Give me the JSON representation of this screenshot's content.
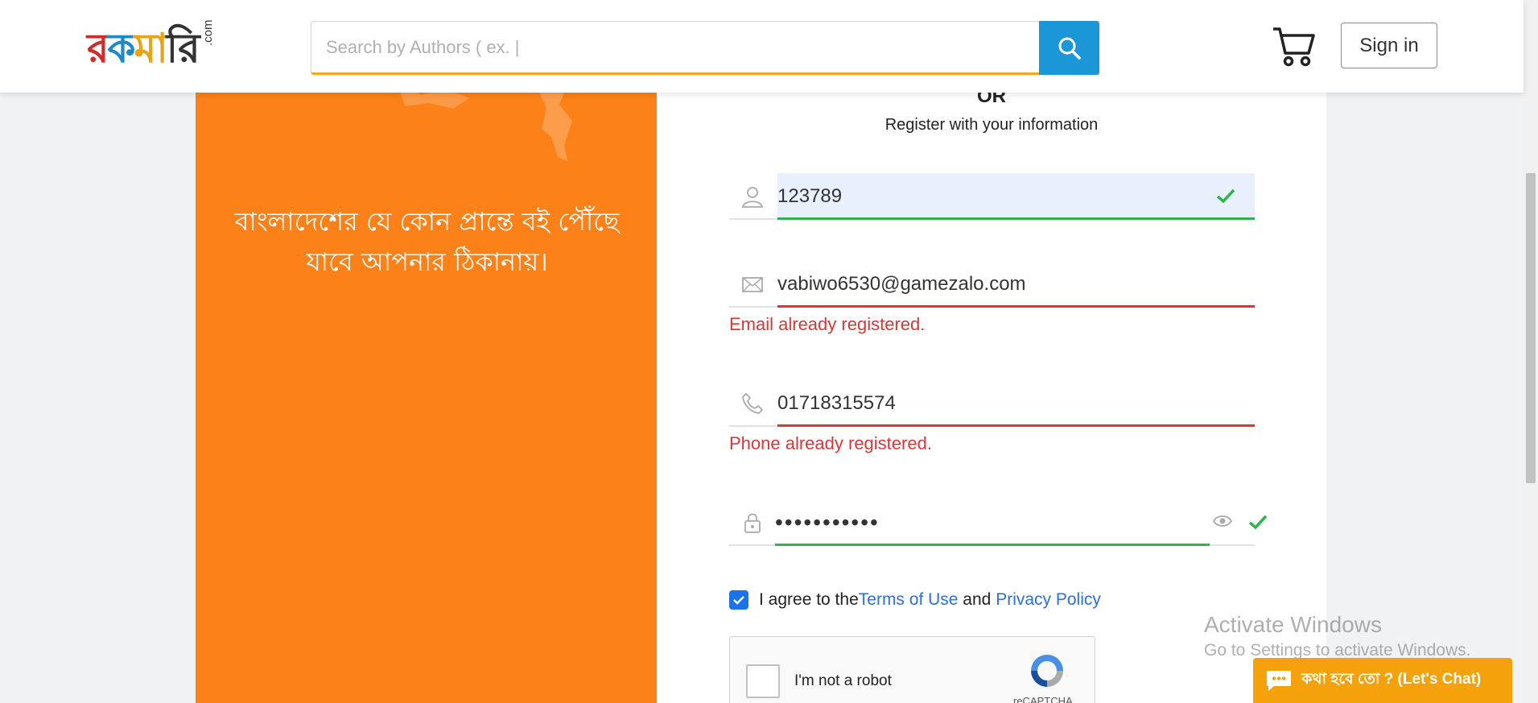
{
  "header": {
    "logo_text": "রকমারি",
    "logo_suffix": ".com",
    "search_placeholder": "Search by Authors ( ex. |",
    "sign_in_label": "Sign in",
    "icons": [
      "search-icon",
      "cart-icon"
    ]
  },
  "promo": {
    "tagline": "বাংলাদেশের যে কোন প্রান্তে বই পৌঁছে যাবে আপনার ঠিকানায়।"
  },
  "form": {
    "or_label": "OR",
    "subtitle": "Register with your information",
    "name_value": "123789",
    "email_value": "vabiwo6530@gamezalo.com",
    "email_error": "Email already registered.",
    "phone_value": "01718315574",
    "phone_error": "Phone already registered.",
    "password_value": "•••••••••••",
    "agree_prefix": "I agree to the ",
    "terms_link": "Terms of Use",
    "agree_and": " and ",
    "privacy_link": "Privacy Policy",
    "recaptcha_label": "I'm not a robot",
    "recaptcha_brand": "reCAPTCHA"
  },
  "overlay": {
    "activate_title": "Activate Windows",
    "activate_sub": "Go to Settings to activate Windows.",
    "chat_label": "কথা হবে তো ? (Let's Chat)"
  },
  "colors": {
    "accent_orange": "#fb8118",
    "search_blue": "#1b97d8",
    "error_red": "#d93636",
    "success_green": "#2fb34a",
    "link_blue": "#2a6fdb",
    "chat_orange": "#f5a10b"
  }
}
